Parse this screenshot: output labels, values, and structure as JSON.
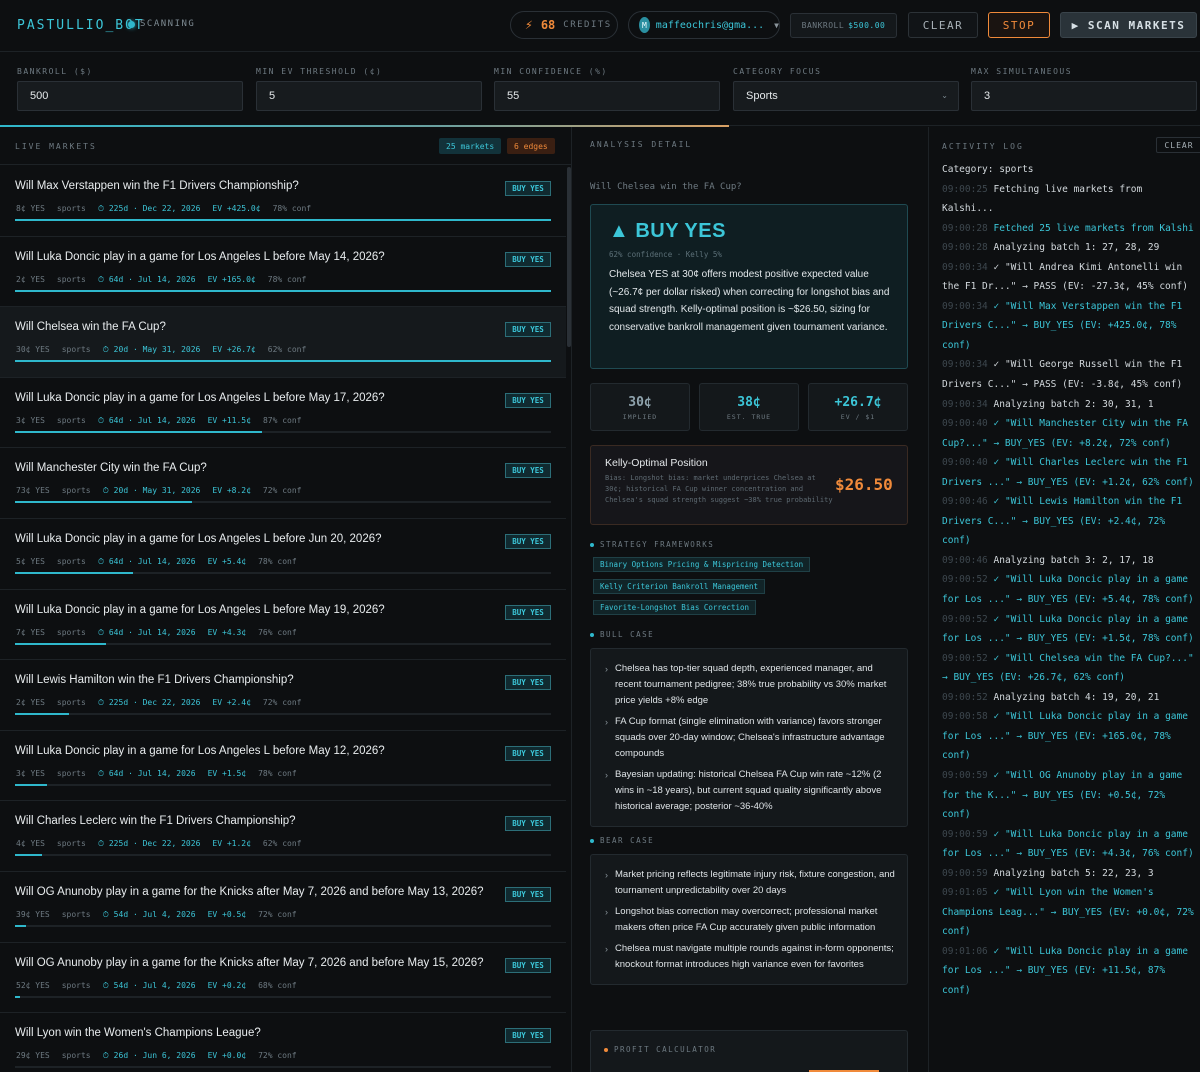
{
  "header": {
    "brand": "PASTULLIO_BOT",
    "status": "SCANNING",
    "credits_count": "68",
    "credits_label": "CREDITS",
    "user_initial": "M",
    "user_email": "maffeochris@gma...",
    "bankroll_label": "BANKROLL",
    "bankroll_value": "$500.00",
    "clear_label": "CLEAR",
    "stop_label": "STOP",
    "scan_label": "▶ SCAN MARKETS"
  },
  "settings": {
    "bankroll": {
      "label": "BANKROLL ($)",
      "value": "500"
    },
    "min_ev": {
      "label": "MIN EV THRESHOLD (¢)",
      "value": "5"
    },
    "min_conf": {
      "label": "MIN CONFIDENCE (%)",
      "value": "55"
    },
    "category": {
      "label": "CATEGORY FOCUS",
      "value": "Sports"
    },
    "max_sim": {
      "label": "MAX SIMULTANEOUS",
      "value": "3"
    },
    "scan_progress": 0.6075
  },
  "live_markets": {
    "title": "LIVE MARKETS",
    "count_tag": "25 markets",
    "edges_tag": "6 edges",
    "rows": [
      {
        "q": "Will Max Verstappen win the F1 Drivers Championship?",
        "price": "8¢ YES",
        "cat": "sports",
        "days": "⏱ 225d · Dec 22, 2026",
        "ev": "EV +425.0¢",
        "conf": "78% conf",
        "action": "BUY YES",
        "fill": 1.0
      },
      {
        "q": "Will Luka Doncic play in a game for Los Angeles L before May 14, 2026?",
        "price": "2¢ YES",
        "cat": "sports",
        "days": "⏱ 64d · Jul 14, 2026",
        "ev": "EV +165.0¢",
        "conf": "78% conf",
        "action": "BUY YES",
        "fill": 1.0
      },
      {
        "q": "Will Chelsea win the FA Cup?",
        "price": "30¢ YES",
        "cat": "sports",
        "days": "⏱ 20d · May 31, 2026",
        "ev": "EV +26.7¢",
        "conf": "62% conf",
        "action": "BUY YES",
        "fill": 1.0
      },
      {
        "q": "Will Luka Doncic play in a game for Los Angeles L before May 17, 2026?",
        "price": "3¢ YES",
        "cat": "sports",
        "days": "⏱ 64d · Jul 14, 2026",
        "ev": "EV +11.5¢",
        "conf": "87% conf",
        "action": "BUY YES",
        "fill": 0.46
      },
      {
        "q": "Will Manchester City win the FA Cup?",
        "price": "73¢ YES",
        "cat": "sports",
        "days": "⏱ 20d · May 31, 2026",
        "ev": "EV +8.2¢",
        "conf": "72% conf",
        "action": "BUY YES",
        "fill": 0.33
      },
      {
        "q": "Will Luka Doncic play in a game for Los Angeles L before Jun 20, 2026?",
        "price": "5¢ YES",
        "cat": "sports",
        "days": "⏱ 64d · Jul 14, 2026",
        "ev": "EV +5.4¢",
        "conf": "78% conf",
        "action": "BUY YES",
        "fill": 0.22
      },
      {
        "q": "Will Luka Doncic play in a game for Los Angeles L before May 19, 2026?",
        "price": "7¢ YES",
        "cat": "sports",
        "days": "⏱ 64d · Jul 14, 2026",
        "ev": "EV +4.3¢",
        "conf": "76% conf",
        "action": "BUY YES",
        "fill": 0.17
      },
      {
        "q": "Will Lewis Hamilton win the F1 Drivers Championship?",
        "price": "2¢ YES",
        "cat": "sports",
        "days": "⏱ 225d · Dec 22, 2026",
        "ev": "EV +2.4¢",
        "conf": "72% conf",
        "action": "BUY YES",
        "fill": 0.1
      },
      {
        "q": "Will Luka Doncic play in a game for Los Angeles L before May 12, 2026?",
        "price": "3¢ YES",
        "cat": "sports",
        "days": "⏱ 64d · Jul 14, 2026",
        "ev": "EV +1.5¢",
        "conf": "78% conf",
        "action": "BUY YES",
        "fill": 0.06
      },
      {
        "q": "Will Charles Leclerc win the F1 Drivers Championship?",
        "price": "4¢ YES",
        "cat": "sports",
        "days": "⏱ 225d · Dec 22, 2026",
        "ev": "EV +1.2¢",
        "conf": "62% conf",
        "action": "BUY YES",
        "fill": 0.05
      },
      {
        "q": "Will OG Anunoby play in a game for the Knicks after May 7, 2026 and before May 13, 2026?",
        "price": "39¢ YES",
        "cat": "sports",
        "days": "⏱ 54d · Jul 4, 2026",
        "ev": "EV +0.5¢",
        "conf": "72% conf",
        "action": "BUY YES",
        "fill": 0.02
      },
      {
        "q": "Will OG Anunoby play in a game for the Knicks after May 7, 2026 and before May 15, 2026?",
        "price": "52¢ YES",
        "cat": "sports",
        "days": "⏱ 54d · Jul 4, 2026",
        "ev": "EV +0.2¢",
        "conf": "68% conf",
        "action": "BUY YES",
        "fill": 0.01
      },
      {
        "q": "Will Lyon win the Women's Champions League?",
        "price": "29¢ YES",
        "cat": "sports",
        "days": "⏱ 26d · Jun 6, 2026",
        "ev": "EV +0.0¢",
        "conf": "72% conf",
        "action": "BUY YES",
        "fill": 0.0
      }
    ]
  },
  "analysis": {
    "title": "ANALYSIS DETAIL",
    "question": "Will Chelsea win the FA Cup?",
    "rec": "▲ BUY YES",
    "rec_sub": "62% confidence · Kelly 5%",
    "rec_text": "Chelsea YES at 30¢ offers modest positive expected value (~26.7¢ per dollar risked) when correcting for longshot bias and squad strength. Kelly-optimal position is ~$26.50, sizing for conservative bankroll management given tournament variance.",
    "stats": [
      {
        "value": "30¢",
        "label": "IMPLIED",
        "color": "#8fa3ad"
      },
      {
        "value": "38¢",
        "label": "EST. TRUE",
        "color": "#3cc6d8"
      },
      {
        "value": "+26.7¢",
        "label": "EV / $1",
        "color": "#3cc6d8"
      }
    ],
    "kelly_title": "Kelly-Optimal Position",
    "kelly_desc": "Bias: Longshot bias: market underprices Chelsea at 30¢; historical FA Cup winner concentration and Chelsea's squad strength suggest ~38% true probability",
    "kelly_amount": "$26.50",
    "frameworks_title": "STRATEGY FRAMEWORKS",
    "frameworks": [
      "Binary Options Pricing & Mispricing Detection",
      "Kelly Criterion Bankroll Management",
      "Favorite-Longshot Bias Correction"
    ],
    "bull_title": "BULL CASE",
    "bull": [
      "Chelsea has top-tier squad depth, experienced manager, and recent tournament pedigree; 38% true probability vs 30% market price yields +8% edge",
      "FA Cup format (single elimination with variance) favors stronger squads over 20-day window; Chelsea's infrastructure advantage compounds",
      "Bayesian updating: historical Chelsea FA Cup win rate ~12% (2 wins in ~18 years), but current squad quality significantly above historical average; posterior ~36-40%"
    ],
    "bear_title": "BEAR CASE",
    "bear": [
      "Market pricing reflects legitimate injury risk, fixture congestion, and tournament unpredictability over 20 days",
      "Longshot bias correction may overcorrect; professional market makers often price FA Cup accurately given public information",
      "Chelsea must navigate multiple rounds against in-form opponents; knockout format introduces high variance even for favorites"
    ],
    "calc_title": "PROFIT CALCULATOR"
  },
  "activity": {
    "title": "ACTIVITY LOG",
    "clear_label": "CLEAR",
    "lines": [
      {
        "ts": "",
        "txt": "Category: sports",
        "cls": ""
      },
      {
        "ts": "09:00:25",
        "txt": "Fetching live markets from Kalshi...",
        "cls": ""
      },
      {
        "ts": "09:00:28",
        "txt": "Fetched 25 live markets from Kalshi",
        "cls": "cy"
      },
      {
        "ts": "09:00:28",
        "txt": "Analyzing batch 1: 27, 28, 29",
        "cls": ""
      },
      {
        "ts": "09:00:34",
        "txt": "✓ \"Will Andrea Kimi Antonelli win the F1 Dr...\" → PASS (EV: -27.3¢, 45% conf)",
        "cls": ""
      },
      {
        "ts": "09:00:34",
        "txt": "✓ \"Will Max Verstappen win the F1 Drivers C...\" → BUY_YES (EV: +425.0¢, 78% conf)",
        "cls": "gn"
      },
      {
        "ts": "09:00:34",
        "txt": "✓ \"Will George Russell win the F1 Drivers C...\" → PASS (EV: -3.8¢, 45% conf)",
        "cls": ""
      },
      {
        "ts": "09:00:34",
        "txt": "Analyzing batch 2: 30, 31, 1",
        "cls": ""
      },
      {
        "ts": "09:00:40",
        "txt": "✓ \"Will Manchester City win the FA Cup?...\" → BUY_YES (EV: +8.2¢, 72% conf)",
        "cls": "gn"
      },
      {
        "ts": "09:00:40",
        "txt": "✓ \"Will Charles Leclerc win the F1 Drivers ...\" → BUY_YES (EV: +1.2¢, 62% conf)",
        "cls": "gn"
      },
      {
        "ts": "09:00:46",
        "txt": "✓ \"Will Lewis Hamilton win the F1 Drivers C...\" → BUY_YES (EV: +2.4¢, 72% conf)",
        "cls": "gn"
      },
      {
        "ts": "09:00:46",
        "txt": "Analyzing batch 3: 2, 17, 18",
        "cls": ""
      },
      {
        "ts": "09:00:52",
        "txt": "✓ \"Will Luka Doncic play in a game for Los ...\" → BUY_YES (EV: +5.4¢, 78% conf)",
        "cls": "gn"
      },
      {
        "ts": "09:00:52",
        "txt": "✓ \"Will Luka Doncic play in a game for Los ...\" → BUY_YES (EV: +1.5¢, 78% conf)",
        "cls": "gn"
      },
      {
        "ts": "09:00:52",
        "txt": "✓ \"Will Chelsea win the FA Cup?...\" → BUY_YES (EV: +26.7¢, 62% conf)",
        "cls": "gn"
      },
      {
        "ts": "09:00:52",
        "txt": "Analyzing batch 4: 19, 20, 21",
        "cls": ""
      },
      {
        "ts": "09:00:58",
        "txt": "✓ \"Will Luka Doncic play in a game for Los ...\" → BUY_YES (EV: +165.0¢, 78% conf)",
        "cls": "gn"
      },
      {
        "ts": "09:00:59",
        "txt": "✓ \"Will OG Anunoby play in a game for the K...\" → BUY_YES (EV: +0.5¢, 72% conf)",
        "cls": "gn"
      },
      {
        "ts": "09:00:59",
        "txt": "✓ \"Will Luka Doncic play in a game for Los ...\" → BUY_YES (EV: +4.3¢, 76% conf)",
        "cls": "gn"
      },
      {
        "ts": "09:00:59",
        "txt": "Analyzing batch 5: 22, 23, 3",
        "cls": ""
      },
      {
        "ts": "09:01:05",
        "txt": "✓ \"Will Lyon win the Women's Champions Leag...\" → BUY_YES (EV: +0.0¢, 72% conf)",
        "cls": "gn"
      },
      {
        "ts": "09:01:06",
        "txt": "✓ \"Will Luka Doncic play in a game for Los ...\" → BUY_YES (EV: +11.5¢, 87% conf)",
        "cls": "gn"
      }
    ]
  }
}
